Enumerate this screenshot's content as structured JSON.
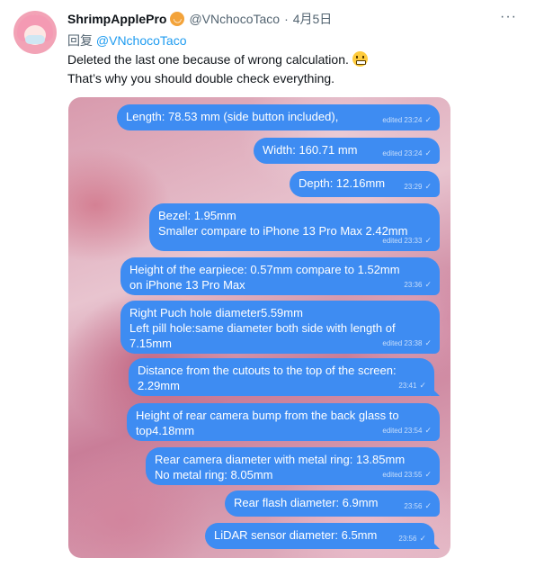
{
  "author": {
    "display_name": "ShrimpApplePro",
    "badge_icon": "shrimp-badge-icon",
    "handle": "@VNchocoTaco",
    "separator": "·",
    "date": "4月5日"
  },
  "more_icon": "···",
  "reply": {
    "prefix": "回复",
    "mention": "@VNchocoTaco"
  },
  "text": {
    "line1": "Deleted the last one because of wrong calculation.",
    "line2": "That’s why you should double check everything."
  },
  "messages": [
    {
      "lines": [
        "Length: 78.53 mm (side button included),"
      ],
      "meta": "edited 23:24",
      "check": "✓"
    },
    {
      "lines": [
        "Width: 160.71 mm"
      ],
      "meta": "edited 23:24",
      "check": "✓"
    },
    {
      "lines": [
        "Depth: 12.16mm"
      ],
      "meta": "23:29",
      "check": "✓"
    },
    {
      "lines": [
        "Bezel: 1.95mm",
        "Smaller compare to iPhone 13 Pro Max 2.42mm"
      ],
      "meta": "edited 23:33",
      "check": "✓"
    },
    {
      "lines": [
        "Height of the earpiece: 0.57mm compare to 1.52mm",
        "on iPhone 13 Pro Max"
      ],
      "meta": "23:36",
      "check": "✓"
    },
    {
      "lines": [
        "Right Puch hole diameter5.59mm",
        "Left pill hole:same diameter both side with length of",
        "7.15mm"
      ],
      "meta": "edited 23:38",
      "check": "✓"
    },
    {
      "lines": [
        "Distance from the cutouts to the top of the screen:",
        "2.29mm"
      ],
      "meta": "23:41",
      "check": "✓"
    },
    {
      "lines": [
        "Height of rear camera bump from the back glass to",
        "top4.18mm"
      ],
      "meta": "edited 23:54",
      "check": "✓"
    },
    {
      "lines": [
        "Rear camera diameter with metal ring: 13.85mm",
        "No metal ring: 8.05mm"
      ],
      "meta": "edited 23:55",
      "check": "✓"
    },
    {
      "lines": [
        "Rear flash diameter: 6.9mm"
      ],
      "meta": "23:56",
      "check": "✓"
    },
    {
      "lines": [
        "LiDAR sensor diameter: 6.5mm"
      ],
      "meta": "23:56",
      "check": "✓"
    }
  ],
  "colors": {
    "bubble": "#3e8cf2",
    "link": "#1d9bf0",
    "secondary_text": "#536471"
  }
}
